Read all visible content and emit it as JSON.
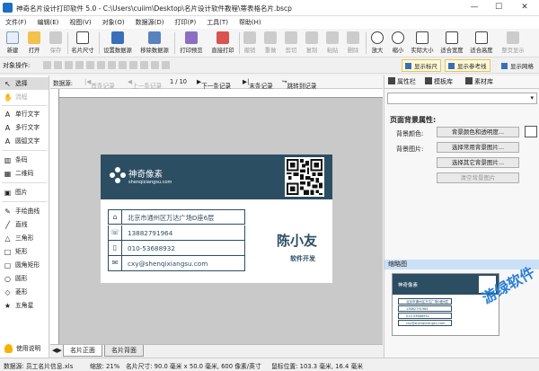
{
  "window": {
    "title": "神奇名片设计打印软件 5.0 - C:\\Users\\cuiim\\Desktop\\名片设计软件教程\\蒂表格名片.bscp",
    "minimize": "—",
    "maximize": "☐",
    "close": "✕"
  },
  "menu": [
    "文件(F)",
    "编辑(E)",
    "视图(V)",
    "对象(O)",
    "数据源(D)",
    "打印(P)",
    "工具(T)",
    "帮助(H)"
  ],
  "toolbar": [
    {
      "label": "新建",
      "icon": "new-file-icon",
      "disabled": false
    },
    {
      "label": "打开",
      "icon": "open-folder-icon",
      "disabled": false
    },
    {
      "label": "保存",
      "icon": "save-icon",
      "disabled": true
    },
    {
      "label": "名片尺寸",
      "icon": "card-size-icon",
      "disabled": false
    },
    {
      "label": "设置数据源",
      "icon": "set-datasource-icon",
      "disabled": false
    },
    {
      "label": "移除数据源",
      "icon": "remove-datasource-icon",
      "disabled": false
    },
    {
      "label": "打印预览",
      "icon": "print-preview-icon",
      "disabled": false
    },
    {
      "label": "直接打印",
      "icon": "print-icon",
      "disabled": false
    },
    {
      "label": "撤销",
      "icon": "undo-icon",
      "disabled": true
    },
    {
      "label": "重做",
      "icon": "redo-icon",
      "disabled": true
    },
    {
      "label": "剪切",
      "icon": "cut-icon",
      "disabled": true
    },
    {
      "label": "复制",
      "icon": "copy-icon",
      "disabled": true
    },
    {
      "label": "粘贴",
      "icon": "paste-icon",
      "disabled": true
    },
    {
      "label": "删除",
      "icon": "delete-icon",
      "disabled": true
    },
    {
      "label": "放大",
      "icon": "zoom-in-icon",
      "disabled": false
    },
    {
      "label": "缩小",
      "icon": "zoom-out-icon",
      "disabled": false
    },
    {
      "label": "实际大小",
      "icon": "actual-size-icon",
      "disabled": false
    },
    {
      "label": "适合宽度",
      "icon": "fit-width-icon",
      "disabled": false
    },
    {
      "label": "适合高度",
      "icon": "fit-height-icon",
      "disabled": false
    },
    {
      "label": "整页显示",
      "icon": "fit-page-icon",
      "disabled": true
    }
  ],
  "objbar": {
    "label": "对象操作:",
    "toggles": [
      "显示标尺",
      "显示参考线",
      "显示网格"
    ]
  },
  "tools": [
    {
      "label": "选择",
      "glyph": "↖",
      "selected": true,
      "disabled": false
    },
    {
      "label": "流程",
      "glyph": "✋",
      "selected": false,
      "disabled": true
    },
    {
      "label": "单行文字",
      "glyph": "A",
      "selected": false,
      "disabled": false
    },
    {
      "label": "多行文字",
      "glyph": "A",
      "selected": false,
      "disabled": false
    },
    {
      "label": "圆弧文字",
      "glyph": "A",
      "selected": false,
      "disabled": false
    },
    {
      "label": "条码",
      "glyph": "▥",
      "selected": false,
      "disabled": false
    },
    {
      "label": "二维码",
      "glyph": "▦",
      "selected": false,
      "disabled": false
    },
    {
      "label": "图片",
      "glyph": "▣",
      "selected": false,
      "disabled": false
    },
    {
      "label": "手绘曲线",
      "glyph": "✎",
      "selected": false,
      "disabled": false
    },
    {
      "label": "直线",
      "glyph": "╱",
      "selected": false,
      "disabled": false
    },
    {
      "label": "三角形",
      "glyph": "△",
      "selected": false,
      "disabled": false
    },
    {
      "label": "矩形",
      "glyph": "□",
      "selected": false,
      "disabled": false
    },
    {
      "label": "圆角矩形",
      "glyph": "▢",
      "selected": false,
      "disabled": false
    },
    {
      "label": "圆形",
      "glyph": "○",
      "selected": false,
      "disabled": false
    },
    {
      "label": "菱形",
      "glyph": "◇",
      "selected": false,
      "disabled": false
    },
    {
      "label": "五角星",
      "glyph": "★",
      "selected": false,
      "disabled": false
    }
  ],
  "help": "使用说明",
  "nav": {
    "datasource": "数据源:",
    "first": "首条记录",
    "prev": "上一条记录",
    "page": "1 / 10",
    "next": "下一条记录",
    "last": "末条记录",
    "jump": "跳转到记录"
  },
  "card": {
    "brand": "神奇像素",
    "brand_sub": "shenqixiangsu.com",
    "rows": [
      {
        "icon": "home-icon",
        "glyph": "⌂",
        "text": "北京市通州区万达广场D座6层"
      },
      {
        "icon": "phone-icon",
        "glyph": "☏",
        "text": "13882791964"
      },
      {
        "icon": "mobile-icon",
        "glyph": "▯",
        "text": "010-53688932"
      },
      {
        "icon": "mail-icon",
        "glyph": "✉",
        "text": "cxy@shenqixiangsu.com"
      }
    ],
    "name": "陈小友",
    "role": "软件开发",
    "color": "#2c4e62"
  },
  "tabs": [
    "名片正面",
    "名片背面"
  ],
  "right": {
    "tabs": [
      "属性栏",
      "模板库",
      "素材库"
    ],
    "section": "页面背景属性:",
    "bg_color_label": "背景颜色:",
    "bg_image_label": "背景图片:",
    "buttons": [
      "背景颜色和透明度...",
      "选择常用背景图片...",
      "选择其它背景图片...",
      "清空背景图片"
    ],
    "thumb_title": "缩略图",
    "thumb_rows": [
      "北京市通州区万达广场D座6层",
      "13882791964",
      "010-53688932",
      "cxy@shenqixiangsu.com"
    ],
    "watermark": "游绿软件"
  },
  "status": {
    "datasource": "数据源: 员工名片信息.xls",
    "zoom": "缩放: 21%",
    "size": "名片尺寸: 90.0 毫米 x 50.0 毫米, 600 像素/英寸",
    "pos": "鼠标位置: 103.3 毫米, 16.4 毫米"
  }
}
